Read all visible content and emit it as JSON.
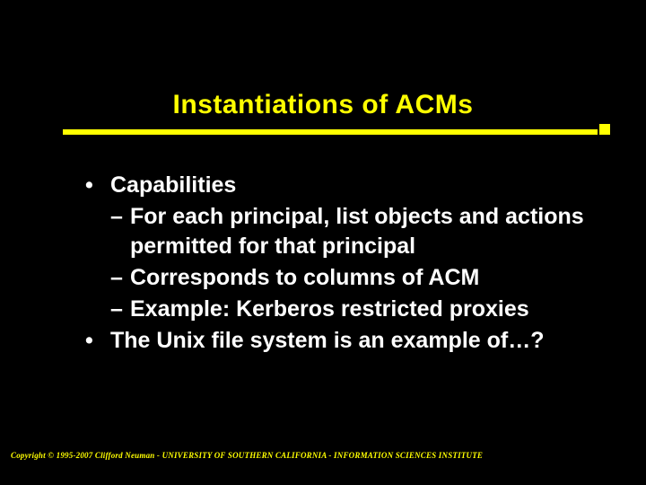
{
  "slide": {
    "title": "Instantiations of ACMs",
    "bullets": [
      {
        "level": 1,
        "text": "Capabilities",
        "children": [
          {
            "level": 2,
            "text": "For each principal, list objects and actions permitted for that principal"
          },
          {
            "level": 2,
            "text": "Corresponds to columns of ACM"
          },
          {
            "level": 2,
            "text": "Example: Kerberos restricted proxies"
          }
        ]
      },
      {
        "level": 1,
        "text": "The Unix file system is an example of…?",
        "children": []
      }
    ],
    "footer": "Copyright © 1995-2007 Clifford Neuman - UNIVERSITY OF SOUTHERN CALIFORNIA - INFORMATION SCIENCES INSTITUTE"
  },
  "glyphs": {
    "bullet_dot": "•",
    "bullet_dash": "–"
  }
}
